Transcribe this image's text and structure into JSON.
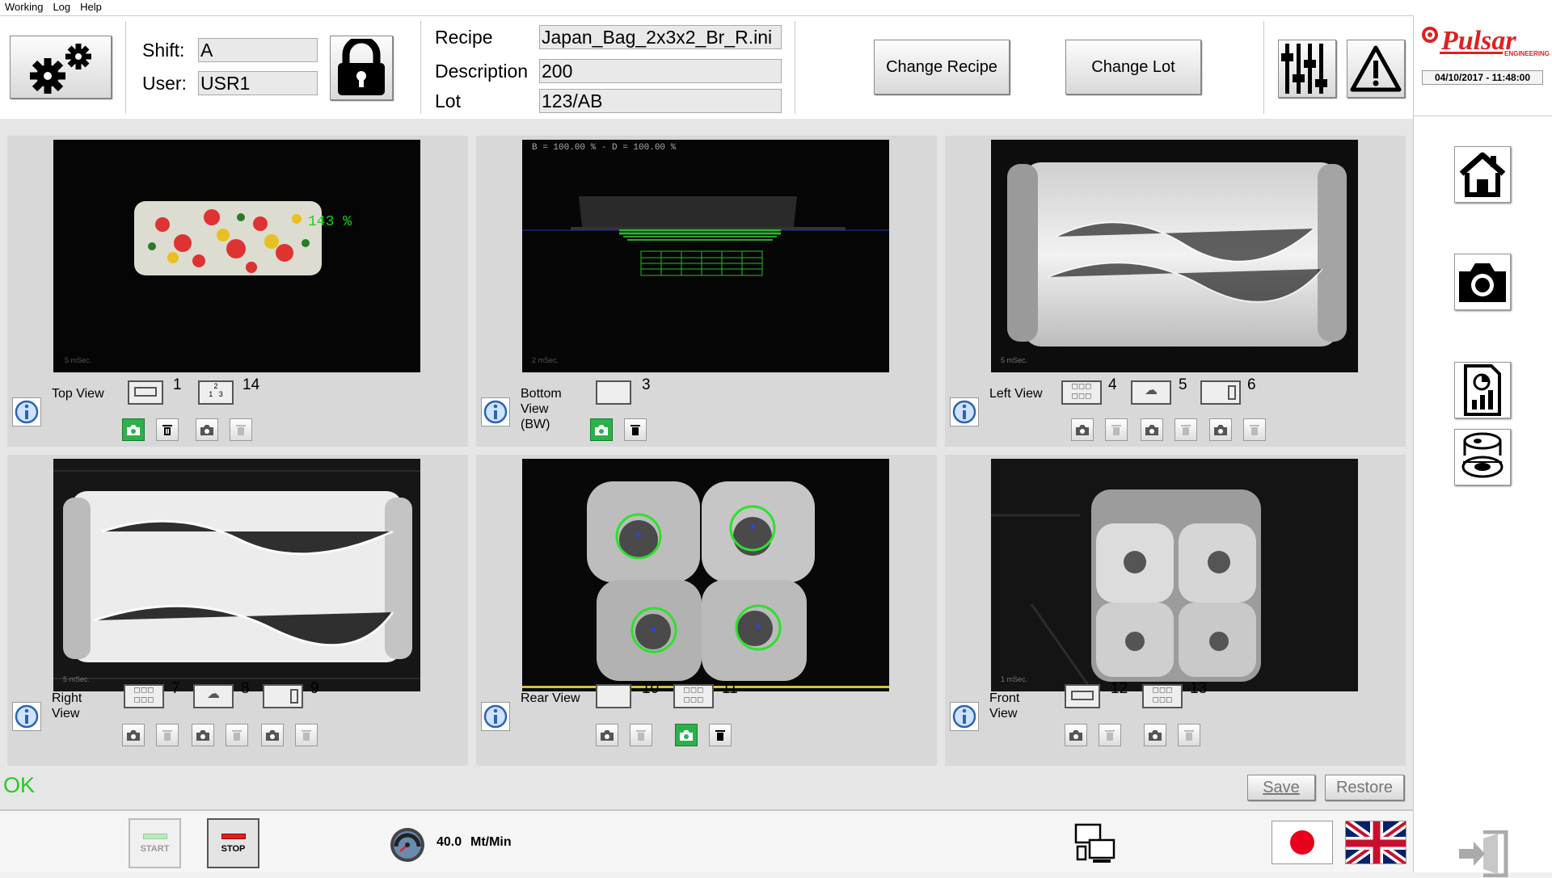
{
  "menu": [
    "Working",
    "Log",
    "Help"
  ],
  "header": {
    "shift_label": "Shift:",
    "shift_value": "A",
    "user_label": "User:",
    "user_value": "USR1",
    "recipe_label": "Recipe",
    "recipe_value": "Japan_Bag_2x3x2_Br_R.ini",
    "description_label": "Description",
    "description_value": "200",
    "lot_label": "Lot",
    "lot_value": "123/AB",
    "change_recipe": "Change Recipe",
    "change_lot": "Change Lot"
  },
  "brand": {
    "name": "Pulsar",
    "tagline": "ENGINEERING",
    "datetime": "04/10/2017 - 11:48:00",
    "color": "#e02020"
  },
  "cams": [
    {
      "name": "Top View",
      "overlay": "143 %",
      "tools": [
        "1",
        "14"
      ]
    },
    {
      "name": "Bottom View (BW)",
      "overlay": "B = 100.00 % - D = 100.00 %",
      "tools": [
        "3"
      ]
    },
    {
      "name": "Left View",
      "tools": [
        "4",
        "5",
        "6"
      ]
    },
    {
      "name": "Right View",
      "tools": [
        "7",
        "8",
        "9"
      ]
    },
    {
      "name": "Rear View",
      "tools": [
        "10",
        "11"
      ]
    },
    {
      "name": "Front View",
      "tools": [
        "12",
        "13"
      ]
    }
  ],
  "status": {
    "text": "OK",
    "color": "#22cc22"
  },
  "actions": {
    "save": "Save",
    "restore": "Restore"
  },
  "bottom": {
    "start": "START",
    "stop": "STOP",
    "speed_value": "40.0",
    "speed_unit": "Mt/Min"
  }
}
